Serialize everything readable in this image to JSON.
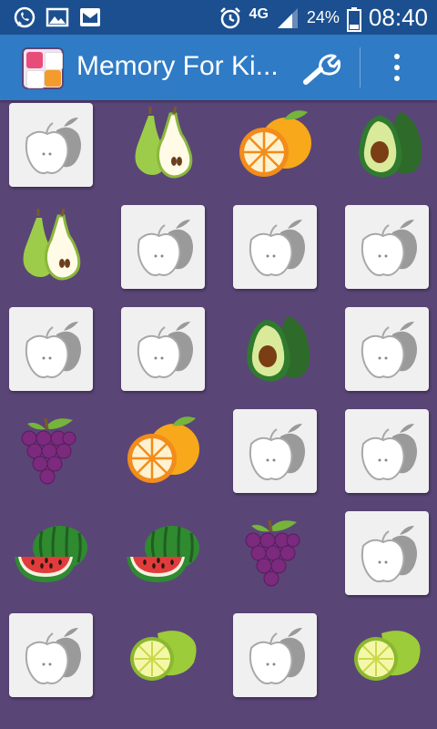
{
  "status_bar": {
    "network": "4G",
    "battery": "24%",
    "time": "08:40",
    "icons": [
      "whatsapp-icon",
      "image-icon",
      "mail-icon",
      "alarm-icon",
      "signal-icon",
      "battery-icon"
    ]
  },
  "app_bar": {
    "title": "Memory For Ki...",
    "actions": [
      "wrench-icon",
      "overflow-menu-icon"
    ]
  },
  "board": {
    "rows": 6,
    "cols": 4,
    "cards": [
      [
        "hidden",
        "pear",
        "orange",
        "avocado"
      ],
      [
        "pear",
        "hidden",
        "hidden",
        "hidden"
      ],
      [
        "hidden",
        "hidden",
        "avocado",
        "hidden"
      ],
      [
        "grapes",
        "orange",
        "hidden",
        "hidden"
      ],
      [
        "watermelon",
        "watermelon",
        "grapes",
        "hidden"
      ],
      [
        "hidden",
        "lime",
        "hidden",
        "lime"
      ]
    ]
  },
  "colors": {
    "status_bar": "#1b4f8f",
    "app_bar": "#2f7bc6",
    "board_background": "#5a4577",
    "card_back": "#f0f0f0"
  }
}
